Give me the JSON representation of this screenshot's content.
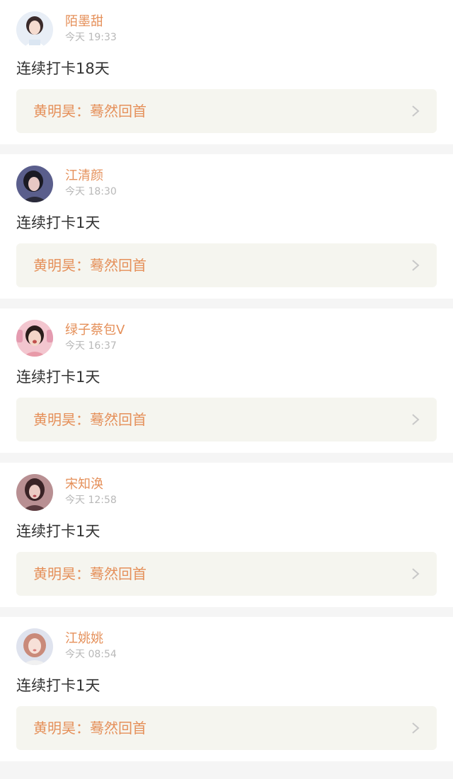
{
  "posts": [
    {
      "username": "陌墨甜",
      "time": "今天 19:33",
      "content": "连续打卡18天",
      "reply": "黄明昊：蓦然回首",
      "avatar": {
        "bg": "#e8eef6",
        "hair": "#3a2a2a",
        "skin": "#f6dcd0",
        "cloth": "#ffffff"
      }
    },
    {
      "username": "江清颜",
      "time": "今天 18:30",
      "content": "连续打卡1天",
      "reply": "黄明昊：蓦然回首",
      "avatar": {
        "bg": "#5a5e8c",
        "hair": "#1b1a24",
        "skin": "#e8c8c4",
        "cloth": "#2a2a3a"
      }
    },
    {
      "username": "绿子蔡包V",
      "time": "今天 16:37",
      "content": "连续打卡1天",
      "reply": "黄明昊：蓦然回首",
      "avatar": {
        "bg": "#f3c6cf",
        "hair": "#2b1d1b",
        "skin": "#f4d6c8",
        "cloth": "#e89aa8"
      }
    },
    {
      "username": "宋知涣",
      "time": "今天 12:58",
      "content": "连续打卡1天",
      "reply": "黄明昊：蓦然回首",
      "avatar": {
        "bg": "#b88f92",
        "hair": "#3a2326",
        "skin": "#eccbc4",
        "cloth": "#5a3a3e"
      }
    },
    {
      "username": "江姚姚",
      "time": "今天 08:54",
      "content": "连续打卡1天",
      "reply": "黄明昊：蓦然回首",
      "avatar": {
        "bg": "#dfe3ee",
        "hair": "#c98a7a",
        "skin": "#f7e0d8",
        "cloth": "#f1f1f1"
      }
    }
  ],
  "colors": {
    "accent": "#e5905a",
    "timestamp": "#b8b8b8",
    "content": "#333333",
    "card": "#f5f5ef",
    "separator": "#f5f5f5"
  }
}
